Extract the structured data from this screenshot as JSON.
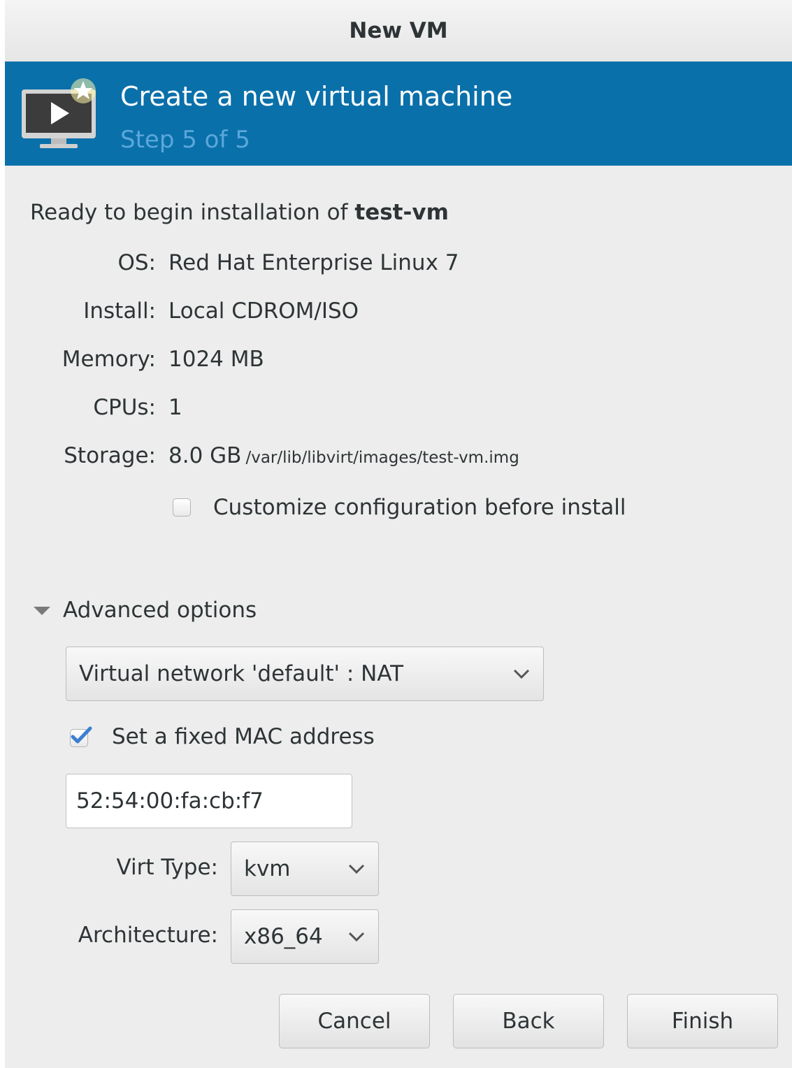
{
  "window": {
    "title": "New VM"
  },
  "header": {
    "title": "Create a new virtual machine",
    "step": "Step 5 of 5",
    "icon": "vm-monitor-icon"
  },
  "summary": {
    "ready_prefix": "Ready to begin installation of ",
    "vm_name": "test-vm",
    "os_label": "OS:",
    "os_value": "Red Hat Enterprise Linux 7",
    "install_label": "Install:",
    "install_value": "Local CDROM/ISO",
    "memory_label": "Memory:",
    "memory_value": "1024 MB",
    "cpus_label": "CPUs:",
    "cpus_value": "1",
    "storage_label": "Storage:",
    "storage_value": "8.0 GB",
    "storage_path": "/var/lib/libvirt/images/test-vm.img"
  },
  "customize": {
    "label": "Customize configuration before install",
    "checked": false
  },
  "advanced": {
    "label": "Advanced options",
    "expanded": true,
    "network_selected": "Virtual network 'default' : NAT",
    "mac_checkbox_label": "Set a fixed MAC address",
    "mac_checked": true,
    "mac_value": "52:54:00:fa:cb:f7",
    "virt_type_label": "Virt Type:",
    "virt_type_value": "kvm",
    "arch_label": "Architecture:",
    "arch_value": "x86_64"
  },
  "buttons": {
    "cancel": "Cancel",
    "back": "Back",
    "finish": "Finish"
  },
  "colors": {
    "header_bg": "#0a70aa",
    "step_text": "#5aa7db",
    "check_mark": "#3b7fd2"
  }
}
